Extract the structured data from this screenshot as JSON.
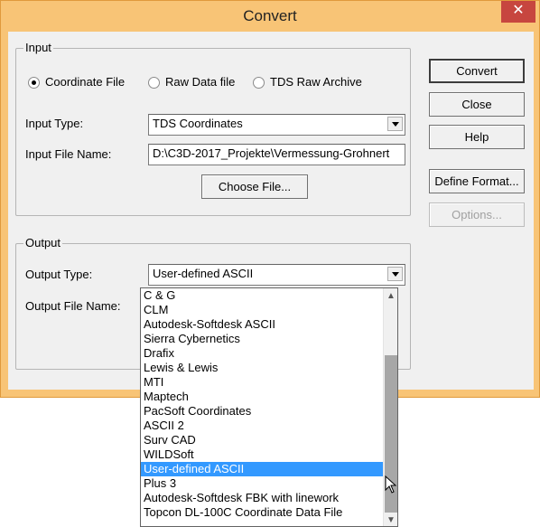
{
  "window": {
    "title": "Convert"
  },
  "input": {
    "group_label": "Input",
    "radios": [
      {
        "label": "Coordinate File",
        "checked": true
      },
      {
        "label": "Raw Data file",
        "checked": false
      },
      {
        "label": "TDS Raw Archive",
        "checked": false
      }
    ],
    "input_type_label": "Input Type:",
    "input_type_value": "TDS Coordinates",
    "input_file_label": "Input File Name:",
    "input_file_value": "D:\\C3D-2017_Projekte\\Vermessung-Grohnert",
    "choose_file_label": "Choose File..."
  },
  "output": {
    "group_label": "Output",
    "output_type_label": "Output Type:",
    "output_type_value": "User-defined ASCII",
    "output_file_label": "Output File Name:"
  },
  "buttons": {
    "convert": "Convert",
    "close": "Close",
    "help": "Help",
    "define_format": "Define Format...",
    "options": "Options..."
  },
  "dropdown": {
    "items": [
      "C & G",
      "CLM",
      "Autodesk-Softdesk ASCII",
      "Sierra Cybernetics",
      "Drafix",
      "Lewis & Lewis",
      "MTI",
      "Maptech",
      "PacSoft Coordinates",
      "ASCII 2",
      "Surv CAD",
      "WILDSoft",
      "User-defined ASCII",
      "Plus 3",
      "Autodesk-Softdesk FBK with linework",
      "Topcon DL-100C Coordinate Data File"
    ],
    "selected_index": 12
  },
  "colors": {
    "titlebar": "#f8c476",
    "close": "#c7463f",
    "selection": "#3399ff"
  }
}
